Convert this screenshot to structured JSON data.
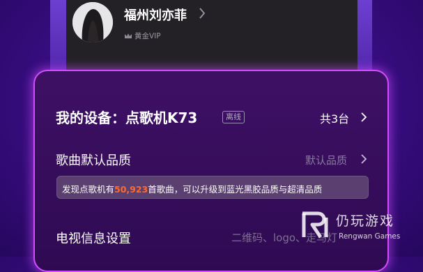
{
  "user": {
    "name": "福州刘亦菲",
    "vip_label": "黄金VIP"
  },
  "device": {
    "title": "我的设备：点歌机K73",
    "status_badge": "离线",
    "count": "共3台"
  },
  "quality": {
    "label": "歌曲默认品质",
    "value": "默认品质"
  },
  "tip": {
    "prefix": "发现点歌机有",
    "count": "50,923",
    "suffix": "首歌曲，可以升级到蓝光黑胶品质与超清品质"
  },
  "tv_settings": {
    "label": "电视信息设置",
    "value": "二维码、logo、走马灯"
  },
  "watermark": {
    "brand_cn": "仍玩游戏",
    "brand_en": "Rengwan Games"
  },
  "colors": {
    "accent_border": "#d24cff",
    "highlight": "#ff6b2b",
    "background": "#3d0f8a"
  }
}
